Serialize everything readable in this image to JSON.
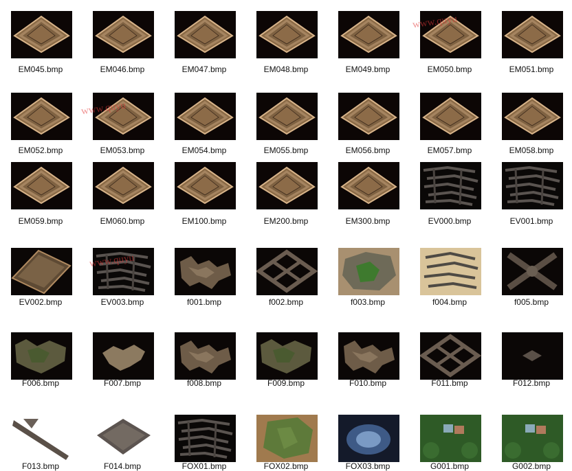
{
  "rows": [
    [
      "EM045.bmp",
      "EM046.bmp",
      "EM047.bmp",
      "EM048.bmp",
      "EM049.bmp",
      "EM050.bmp",
      "EM051.bmp"
    ],
    [
      "EM052.bmp",
      "EM053.bmp",
      "EM054.bmp",
      "EM055.bmp",
      "EM056.bmp",
      "EM057.bmp",
      "EM058.bmp"
    ],
    [
      "EM059.bmp",
      "EM060.bmp",
      "EM100.bmp",
      "EM200.bmp",
      "EM300.bmp",
      "EV000.bmp",
      "EV001.bmp"
    ],
    [
      "EV002.bmp",
      "EV003.bmp",
      "f001.bmp",
      "f002.bmp",
      "f003.bmp",
      "f004.bmp",
      "f005.bmp"
    ],
    [
      "F006.bmp",
      "F007.bmp",
      "f008.bmp",
      "F009.bmp",
      "F010.bmp",
      "F011.bmp",
      "F012.bmp"
    ],
    [
      "F013.bmp",
      "F014.bmp",
      "FOX01.bmp",
      "FOX02.bmp",
      "FOX03.bmp",
      "G001.bmp",
      "G002.bmp"
    ]
  ],
  "thumb_kinds": [
    [
      "diamond",
      "diamond",
      "diamond",
      "diamond",
      "diamond",
      "diamond",
      "diamond"
    ],
    [
      "diamond",
      "diamond",
      "diamond",
      "diamond",
      "diamond",
      "diamond",
      "diamond"
    ],
    [
      "diamond",
      "diamond",
      "diamond",
      "diamond",
      "diamond",
      "maze",
      "maze"
    ],
    [
      "room",
      "maze",
      "cave",
      "crossroad",
      "islandgreen",
      "mazebeige",
      "cross"
    ],
    [
      "greencave",
      "plaza",
      "cave",
      "greencave",
      "cave",
      "crossroad",
      "smallcross"
    ],
    [
      "diagonal",
      "smalldiamond",
      "maze",
      "forestmap",
      "bluecity",
      "forest",
      "forest"
    ]
  ],
  "watermark_text": "www.quyu"
}
